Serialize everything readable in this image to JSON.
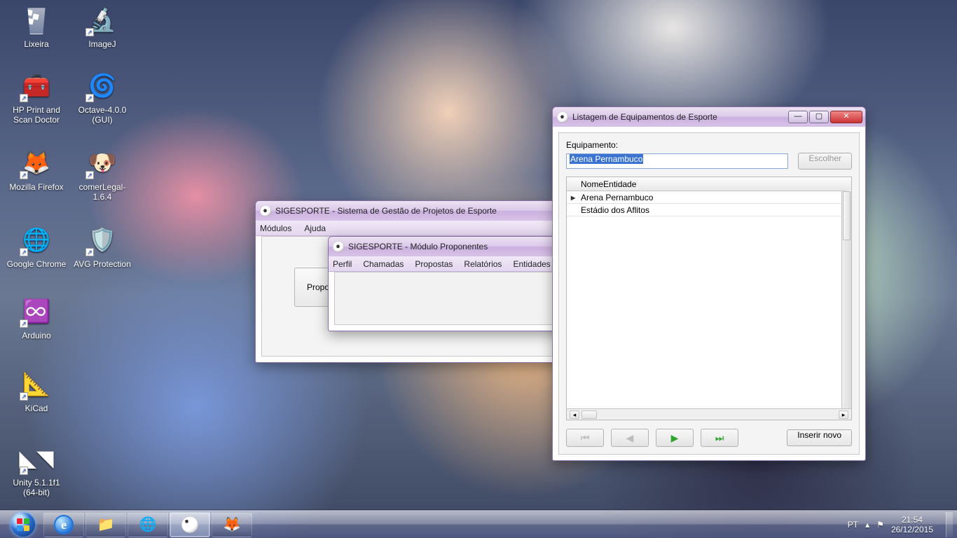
{
  "desktop_icons": [
    {
      "label": "Lixeira"
    },
    {
      "label": "ImageJ"
    },
    {
      "label": "HP Print and Scan Doctor"
    },
    {
      "label": "Octave-4.0.0 (GUI)"
    },
    {
      "label": "Mozilla Firefox"
    },
    {
      "label": "comerLegal-1.6.4"
    },
    {
      "label": "Google Chrome"
    },
    {
      "label": "AVG Protection"
    },
    {
      "label": "Arduino"
    },
    {
      "label": "KiCad"
    },
    {
      "label": "Unity 5.1.1f1 (64-bit)"
    }
  ],
  "window_main": {
    "title": "SIGESPORTE - Sistema de Gestão de Projetos de Esporte",
    "menu": [
      "Módulos",
      "Ajuda"
    ],
    "button_proponentes": "Propor"
  },
  "window_prop": {
    "title": "SIGESPORTE - Módulo Proponentes",
    "menu": [
      "Perfil",
      "Chamadas",
      "Propostas",
      "Relatórios",
      "Entidades"
    ]
  },
  "window_list": {
    "title": "Listagem de Equipamentos de Esporte",
    "label_equipamento": "Equipamento:",
    "input_value": "Arena Pernambuco",
    "btn_escolher": "Escolher",
    "column_header": "NomeEntidade",
    "rows": [
      "Arena Pernambuco",
      "Estádio dos Aflitos"
    ],
    "btn_inserir": "Inserir novo"
  },
  "tray": {
    "lang": "PT",
    "time": "21:54",
    "date": "26/12/2015"
  }
}
